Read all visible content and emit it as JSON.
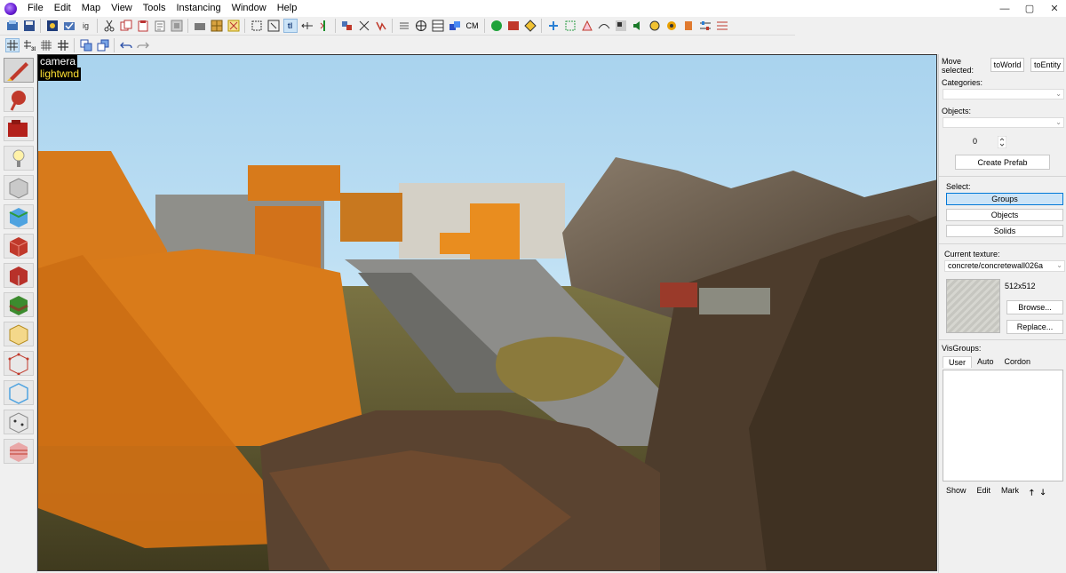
{
  "menu": {
    "items": [
      "File",
      "Edit",
      "Map",
      "View",
      "Tools",
      "Instancing",
      "Window",
      "Help"
    ]
  },
  "window_controls": [
    "—",
    "▢",
    "✕"
  ],
  "toolbar1": {
    "icons": [
      "load-icon",
      "save-icon",
      "run-map-icon",
      "check-icon",
      "ig-icon",
      "cut-icon",
      "copy-icon",
      "paste-icon",
      "paste-special-icon",
      "carve-icon",
      "grid-icon",
      "tie-icon",
      "texture-lock-icon",
      "tl-icon",
      "align-icon",
      "group-icon",
      "hide-icon",
      "cm-icon",
      "cordon-icon",
      "entity-icon",
      "decal-icon",
      "overlay-icon",
      "clip-icon",
      "vertex-icon",
      "morph-icon",
      "path-icon",
      "visgroup-icon",
      "sound-icon",
      "physics-icon",
      "particle-icon",
      "ruler-icon",
      "settings-icon"
    ],
    "text_buttons": {
      "tl": "tl",
      "cm": "CM"
    }
  },
  "toolbar2": {
    "icons": [
      "grid-toggle-icon",
      "3d-grid-icon",
      "grid-small-icon",
      "grid-large-icon",
      "bring-forward-icon",
      "send-back-icon",
      "undo-icon",
      "redo-icon"
    ]
  },
  "lefttools": {
    "tools": [
      "selection-tool",
      "magnify-tool",
      "camera-tool",
      "entity-tool",
      "block-tool",
      "texture-application-tool",
      "apply-texture-tool",
      "decal-tool",
      "overlay-tool",
      "clipping-tool",
      "vertex-tool",
      "path-tool",
      "sprinkle-tool",
      "cordon-tool"
    ]
  },
  "viewport": {
    "camera_label": "camera",
    "mode_label": "lightwnd"
  },
  "rightpanel": {
    "move_selected": "Move\nselected:",
    "to_world": "toWorld",
    "to_entity": "toEntity",
    "categories_label": "Categories:",
    "objects_label": "Objects:",
    "counter_value": "0",
    "create_prefab": "Create Prefab",
    "select_label": "Select:",
    "groups": "Groups",
    "objects": "Objects",
    "solids": "Solids",
    "current_texture_label": "Current texture:",
    "current_texture": "concrete/concretewall026a",
    "texture_size": "512x512",
    "browse": "Browse...",
    "replace": "Replace...",
    "visgroups_label": "VisGroups:",
    "vis_tabs": [
      "User",
      "Auto",
      "Cordon"
    ],
    "vis_actions": [
      "Show",
      "Edit",
      "Mark"
    ],
    "arrows": [
      "🡑",
      "🡓"
    ]
  },
  "colors": {
    "accent": "#0078d7",
    "sky": "#bfe0f4",
    "orange_block": "#d77a1b",
    "rock": "#5a4736"
  }
}
